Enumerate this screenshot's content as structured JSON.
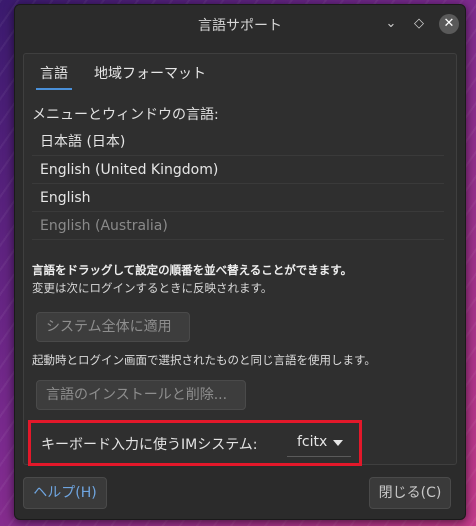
{
  "window": {
    "title": "言語サポート",
    "minimize_glyph": "⌄",
    "maximize_glyph": "◇",
    "close_glyph": "✕"
  },
  "tabs": [
    {
      "label": "言語",
      "active": true
    },
    {
      "label": "地域フォーマット",
      "active": false
    }
  ],
  "languages": {
    "section_label": "メニューとウィンドウの言語:",
    "items": [
      {
        "label": "日本語 (日本)",
        "enabled": true
      },
      {
        "label": "English (United Kingdom)",
        "enabled": true
      },
      {
        "label": "English",
        "enabled": true
      },
      {
        "label": "English (Australia)",
        "enabled": false
      }
    ]
  },
  "hints": {
    "drag_bold": "言語をドラッグして設定の順番を並べ替えることができます。",
    "drag_note": "変更は次にログインするときに反映されます。",
    "login_note": "起動時とログイン画面で選択されたものと同じ言語を使用します。"
  },
  "buttons": {
    "apply_system_wide": "システム全体に適用",
    "install_remove": "言語のインストールと削除...",
    "help": "ヘルプ(H)",
    "close": "閉じる(C)"
  },
  "input_method": {
    "label": "キーボード入力に使うIMシステム:",
    "selected": "fcitx"
  },
  "colors": {
    "accent": "#4a90d9",
    "highlight_box": "#e3182a",
    "help_text": "#6fa5e0"
  }
}
